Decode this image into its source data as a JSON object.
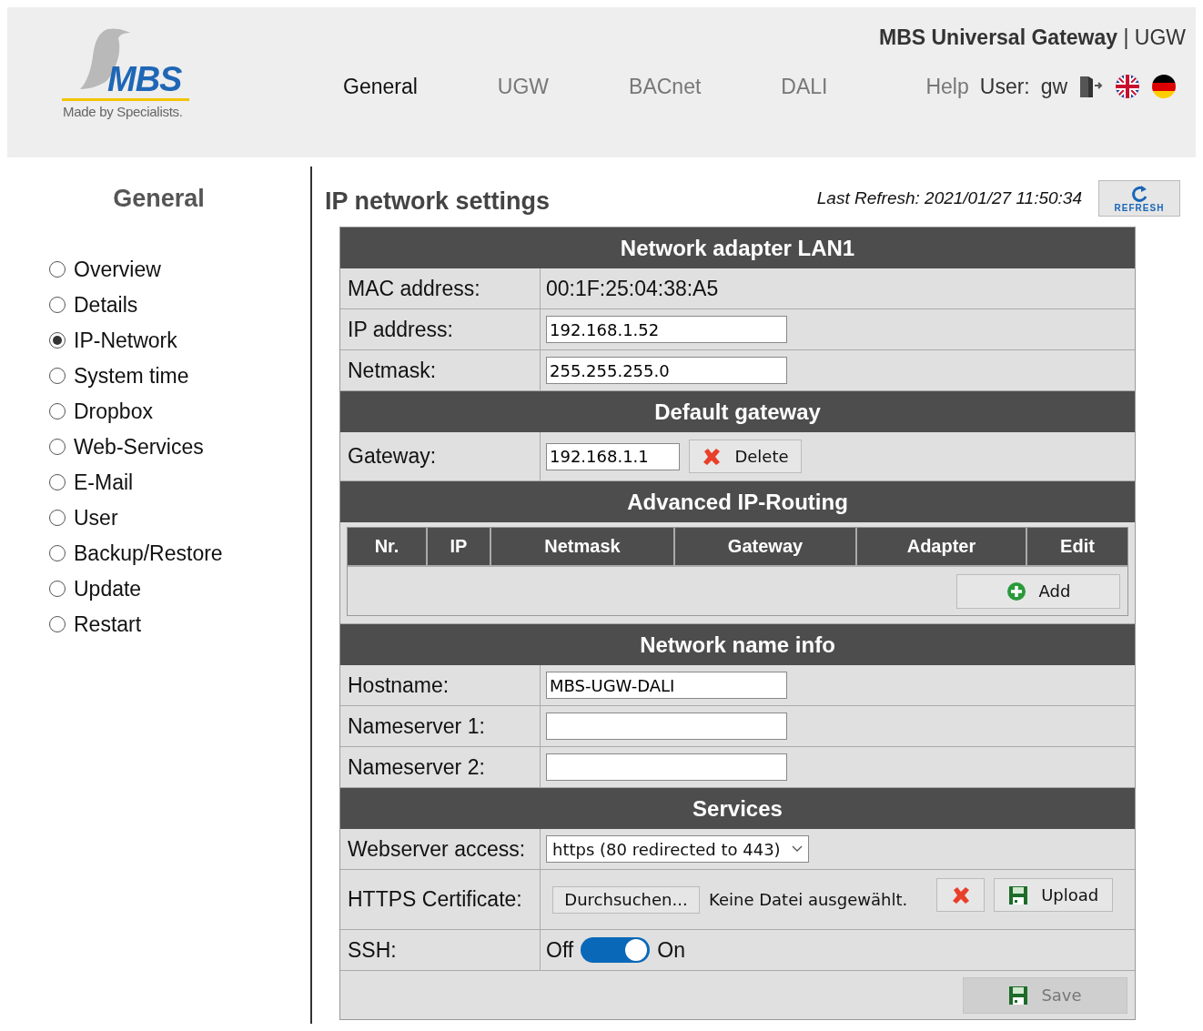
{
  "header": {
    "logo": {
      "brand": "MBS",
      "tagline": "Made by Specialists."
    },
    "title_bold": "MBS Universal Gateway",
    "title_rest": "| UGW",
    "nav": [
      {
        "label": "General",
        "selected": true
      },
      {
        "label": "UGW",
        "selected": false
      },
      {
        "label": "BACnet",
        "selected": false
      },
      {
        "label": "DALI",
        "selected": false
      }
    ],
    "help": "Help",
    "user_label": "User:",
    "user_name": "gw"
  },
  "sidebar": {
    "title": "General",
    "items": [
      {
        "label": "Overview",
        "selected": false
      },
      {
        "label": "Details",
        "selected": false
      },
      {
        "label": "IP-Network",
        "selected": true
      },
      {
        "label": "System time",
        "selected": false
      },
      {
        "label": "Dropbox",
        "selected": false
      },
      {
        "label": "Web-Services",
        "selected": false
      },
      {
        "label": "E-Mail",
        "selected": false
      },
      {
        "label": "User",
        "selected": false
      },
      {
        "label": "Backup/Restore",
        "selected": false
      },
      {
        "label": "Update",
        "selected": false
      },
      {
        "label": "Restart",
        "selected": false
      }
    ]
  },
  "main": {
    "title": "IP network settings",
    "last_refresh": "Last Refresh: 2021/01/27 11:50:34",
    "refresh_button": "REFRESH",
    "sections": [
      {
        "title": "Network adapter LAN1",
        "rows": [
          {
            "kind": "text",
            "label": "MAC address:",
            "value": "00:1F:25:04:38:A5"
          },
          {
            "kind": "input",
            "label": "IP address:",
            "value": "192.168.1.52"
          },
          {
            "kind": "input",
            "label": "Netmask:",
            "value": "255.255.255.0"
          }
        ]
      },
      {
        "title": "Default gateway",
        "rows": [
          {
            "kind": "input_delete",
            "label": "Gateway:",
            "value": "192.168.1.1",
            "button": "Delete"
          }
        ]
      },
      {
        "title": "Advanced IP-Routing",
        "rows": [
          {
            "kind": "routing_table",
            "columns": [
              "Nr.",
              "IP",
              "Netmask",
              "Gateway",
              "Adapter",
              "Edit"
            ],
            "button": "Add"
          }
        ]
      },
      {
        "title": "Network name info",
        "rows": [
          {
            "kind": "input",
            "label": "Hostname:",
            "value": "MBS-UGW-DALI"
          },
          {
            "kind": "input",
            "label": "Nameserver 1:"
          },
          {
            "kind": "input",
            "label": "Nameserver 2:"
          }
        ]
      },
      {
        "title": "Services",
        "rows": [
          {
            "kind": "select",
            "label": "Webserver access:",
            "value": "https (80 redirected to 443)"
          },
          {
            "kind": "file",
            "label": "HTTPS Certificate:",
            "browse": "Durchsuchen...",
            "file_status": "Keine Datei ausgewählt.",
            "button": "Upload"
          },
          {
            "kind": "toggle",
            "label": "SSH:",
            "off_label": "Off",
            "on_label": "On",
            "on": true
          }
        ]
      }
    ],
    "save_button": {
      "label": "Save",
      "disabled": true
    }
  }
}
